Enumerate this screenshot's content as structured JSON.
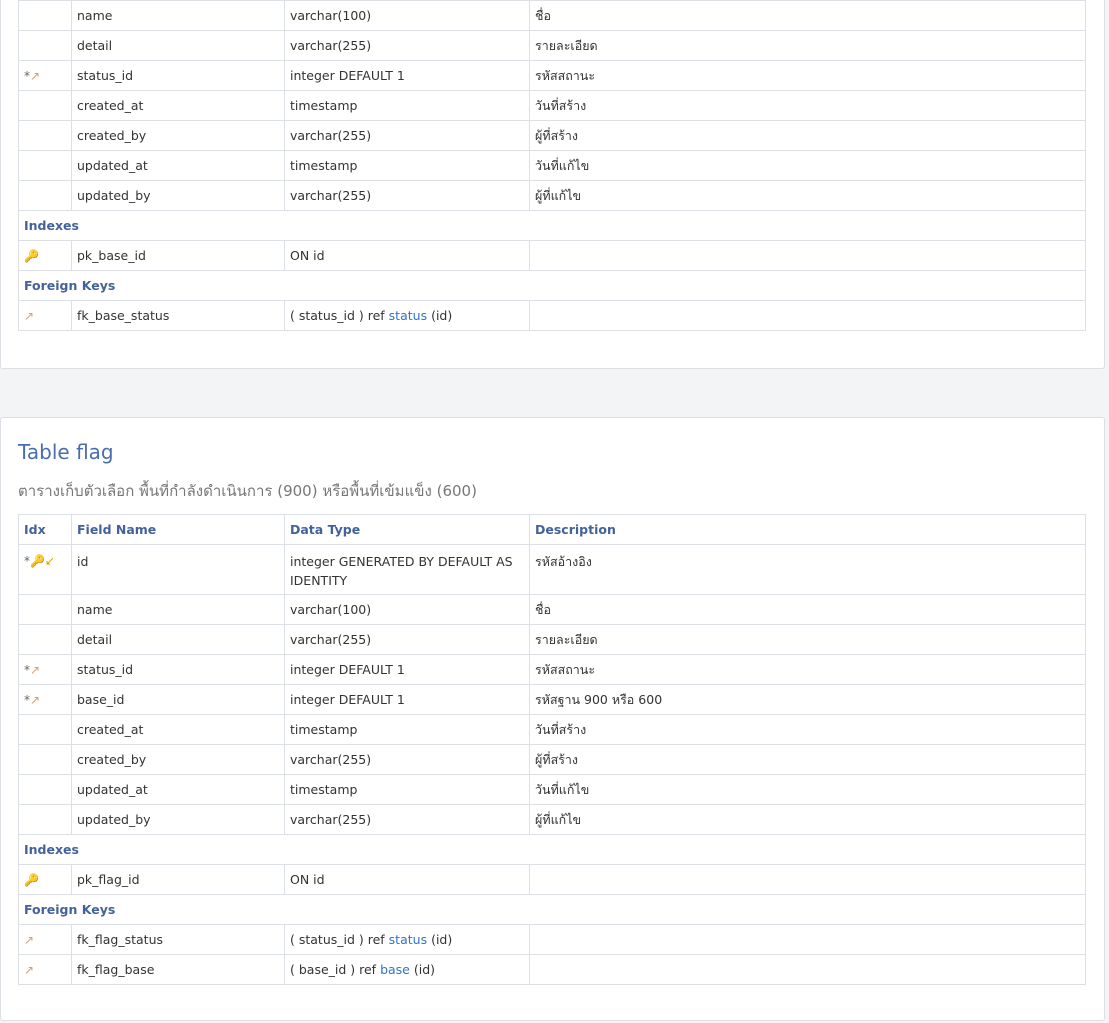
{
  "base_table": {
    "rows": [
      {
        "idx": "",
        "field": "name",
        "type": "varchar(100)",
        "desc": "ชื่อ"
      },
      {
        "idx": "*↗",
        "field": "detail",
        "type": "varchar(255)",
        "desc": "รายละเอียด"
      },
      {
        "idx": "*↗",
        "field": "status_id",
        "type": "integer DEFAULT 1",
        "desc": "รหัสสถานะ"
      },
      {
        "idx": "",
        "field": "created_at",
        "type": "timestamp",
        "desc": "วันที่สร้าง"
      },
      {
        "idx": "",
        "field": "created_by",
        "type": "varchar(255)",
        "desc": "ผู้ที่สร้าง"
      },
      {
        "idx": "",
        "field": "updated_at",
        "type": "timestamp",
        "desc": "วันที่แก้ไข"
      },
      {
        "idx": "",
        "field": "updated_by",
        "type": "varchar(255)",
        "desc": "ผู้ที่แก้ไข"
      }
    ],
    "indexes_label": "Indexes",
    "index": {
      "name": "pk_base_id",
      "def": "ON id"
    },
    "fk_label": "Foreign Keys",
    "fks": [
      {
        "name": "fk_base_status",
        "pre": "( status_id ) ref ",
        "ref": "status",
        "post": " (id)"
      }
    ]
  },
  "flag_table": {
    "title": "Table flag",
    "subtitle": "ตารางเก็บตัวเลือก พื้นที่กำลังดำเนินการ (900) หรือพื้นที่เข้มแข็ง (600)",
    "headers": {
      "idx": "Idx",
      "field": "Field Name",
      "type": "Data Type",
      "desc": "Description"
    },
    "rows": [
      {
        "field": "id",
        "type": "integer GENERATED BY DEFAULT AS IDENTITY",
        "desc": "รหัสอ้างอิง"
      },
      {
        "field": "name",
        "type": "varchar(100)",
        "desc": "ชื่อ"
      },
      {
        "field": "detail",
        "type": "varchar(255)",
        "desc": "รายละเอียด"
      },
      {
        "field": "status_id",
        "type": "integer DEFAULT 1",
        "desc": "รหัสสถานะ"
      },
      {
        "field": "base_id",
        "type": "integer DEFAULT 1",
        "desc": "รหัสฐาน 900 หรือ 600"
      },
      {
        "field": "created_at",
        "type": "timestamp",
        "desc": "วันที่สร้าง"
      },
      {
        "field": "created_by",
        "type": "varchar(255)",
        "desc": "ผู้ที่สร้าง"
      },
      {
        "field": "updated_at",
        "type": "timestamp",
        "desc": "วันที่แก้ไข"
      },
      {
        "field": "updated_by",
        "type": "varchar(255)",
        "desc": "ผู้ที่แก้ไข"
      }
    ],
    "indexes_label": "Indexes",
    "index": {
      "name": "pk_flag_id",
      "def": "ON id"
    },
    "fk_label": "Foreign Keys",
    "fks": [
      {
        "name": "fk_flag_status",
        "pre": "( status_id ) ref ",
        "ref": "status",
        "post": " (id)"
      },
      {
        "name": "fk_flag_base",
        "pre": "( base_id ) ref ",
        "ref": "base",
        "post": " (id)"
      }
    ]
  },
  "icons": {
    "primary_key": "key-icon",
    "foreign_key": "foreign-key-arrow-icon",
    "referenced_by": "referenced-by-arrow-icon",
    "key_color": "#d9a400",
    "ref_color": "#d4a06a",
    "link_color": "#2f74c8",
    "heading_color": "#44629a"
  }
}
